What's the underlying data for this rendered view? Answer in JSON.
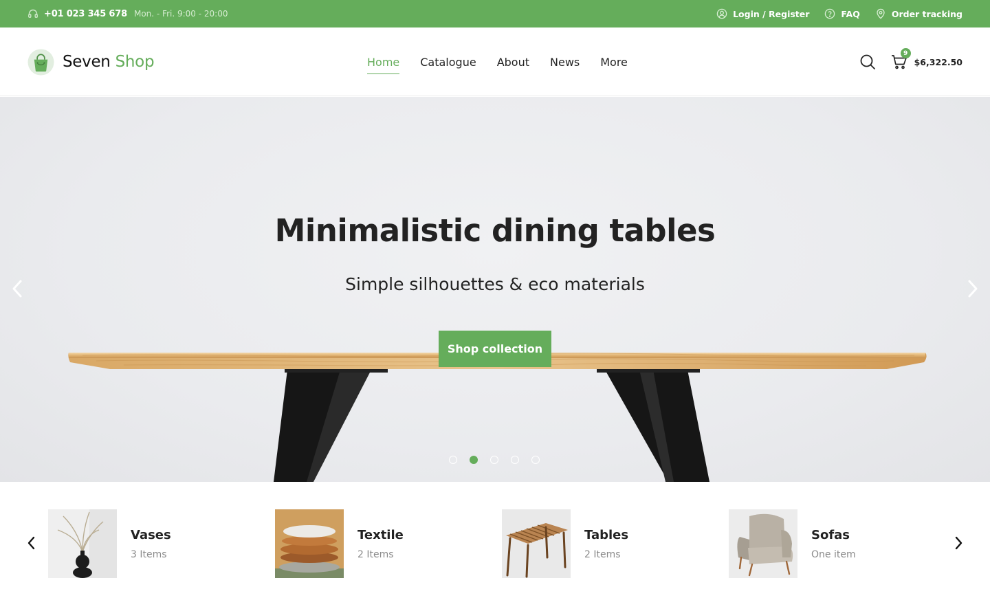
{
  "topbar": {
    "phone": "+01 023 345 678",
    "hours": "Mon. - Fri. 9:00 - 20:00",
    "links": [
      {
        "label": "Login / Register",
        "icon": "user-icon"
      },
      {
        "label": "FAQ",
        "icon": "question-icon"
      },
      {
        "label": "Order tracking",
        "icon": "location-pin-icon"
      }
    ]
  },
  "brand": {
    "name_part1": "Seven",
    "name_part2": "Shop",
    "accent_color": "#65ad5b"
  },
  "nav": {
    "items": [
      "Home",
      "Catalogue",
      "About",
      "News",
      "More"
    ],
    "active": "Home"
  },
  "cart": {
    "count": "9",
    "total": "$6,322.50"
  },
  "hero": {
    "title": "Minimalistic dining tables",
    "subtitle": "Simple silhouettes & eco materials",
    "cta_label": "Shop collection",
    "slides_total": 5,
    "active_slide": 2
  },
  "categories": [
    {
      "name": "Vases",
      "count": "3 Items"
    },
    {
      "name": "Textile",
      "count": "2 Items"
    },
    {
      "name": "Tables",
      "count": "2 Items"
    },
    {
      "name": "Sofas",
      "count": "One item"
    }
  ]
}
